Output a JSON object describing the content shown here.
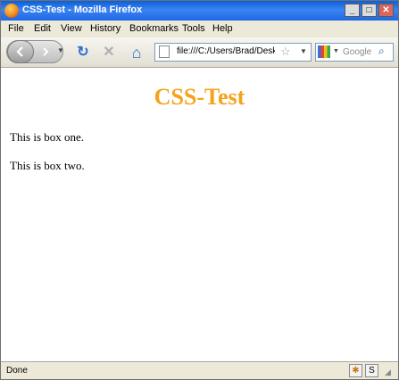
{
  "window": {
    "title": "CSS-Test - Mozilla Firefox"
  },
  "title_buttons": {
    "minimize": "_",
    "maximize": "□",
    "close": "✕"
  },
  "menu": [
    "File",
    "Edit",
    "View",
    "History",
    "Bookmarks",
    "Tools",
    "Help"
  ],
  "toolbar": {
    "back_icon": "arrow-left-icon",
    "forward_icon": "arrow-right-icon",
    "reload_glyph": "↻",
    "stop_glyph": "✕",
    "home_glyph": "⌂",
    "url": "file:///C:/Users/Brad/Desktop/",
    "star_glyph": "☆",
    "search_placeholder": "Google",
    "search_glyph": "⌕"
  },
  "page": {
    "heading": "CSS-Test",
    "box_one": "This is box one.",
    "box_two": "This is box two."
  },
  "status": {
    "text": "Done",
    "addon_glyph": "✱",
    "s_glyph": "S"
  },
  "colors": {
    "heading": "#f5a31a",
    "titlebar": "#0a5fd8"
  }
}
